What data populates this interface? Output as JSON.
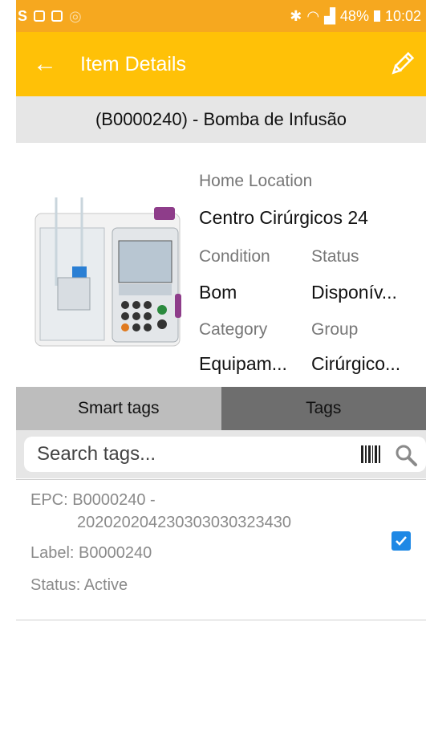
{
  "status_bar": {
    "battery": "48%",
    "time": "10:02"
  },
  "app_bar": {
    "title": "Item Details"
  },
  "item": {
    "header": "(B0000240) - Bomba de Infusão",
    "home_location_label": "Home Location",
    "home_location_value": "Centro Cirúrgicos 24",
    "condition_label": "Condition",
    "condition_value": "Bom",
    "status_label": "Status",
    "status_value": "Disponív...",
    "category_label": "Category",
    "category_value": "Equipam...",
    "group_label": "Group",
    "group_value": "Cirúrgico..."
  },
  "tabs": {
    "smart_tags": "Smart tags",
    "tags": "Tags"
  },
  "search": {
    "placeholder": "Search tags..."
  },
  "tag_list": [
    {
      "epc_line1": "EPC: B0000240 -",
      "epc_line2": "202020204230303030323430",
      "label": "Label: B0000240",
      "status": "Status: Active",
      "checked": true
    }
  ],
  "colors": {
    "status_bar": "#f6a81f",
    "app_bar": "#ffc107",
    "checkbox": "#1e88e5"
  }
}
